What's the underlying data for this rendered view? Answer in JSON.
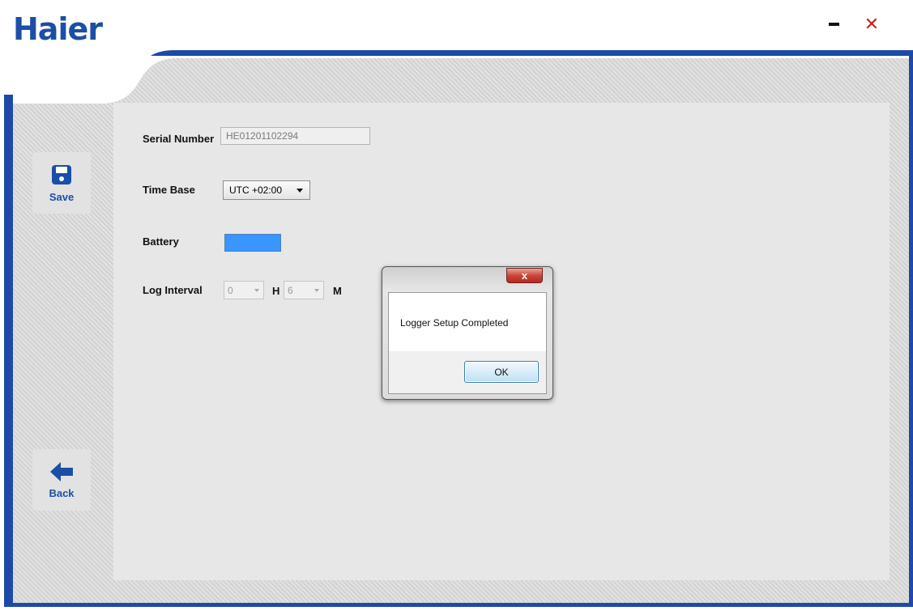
{
  "header": {
    "logo_text": "Haier",
    "minimize_icon": "minimize-icon",
    "close_icon": "close-icon"
  },
  "colors": {
    "frame_blue": "#1d4aa8",
    "accent_red": "#d21c1c",
    "battery_fill": "#3a95ff"
  },
  "sidebar": {
    "save": {
      "label": "Save",
      "icon": "floppy-disk-icon"
    },
    "back": {
      "label": "Back",
      "icon": "arrow-left-icon"
    }
  },
  "form": {
    "serial_number": {
      "label": "Serial Number",
      "value": "HE01201102294"
    },
    "time_base": {
      "label": "Time Base",
      "value": "UTC +02:00"
    },
    "battery": {
      "label": "Battery",
      "level": 1.0
    },
    "log_interval": {
      "label": "Log Interval",
      "hours": "0",
      "hours_unit": "H",
      "minutes": "6",
      "minutes_unit": "M"
    }
  },
  "dialog": {
    "message": "Logger Setup Completed",
    "ok_label": "OK",
    "close_glyph": "x"
  }
}
